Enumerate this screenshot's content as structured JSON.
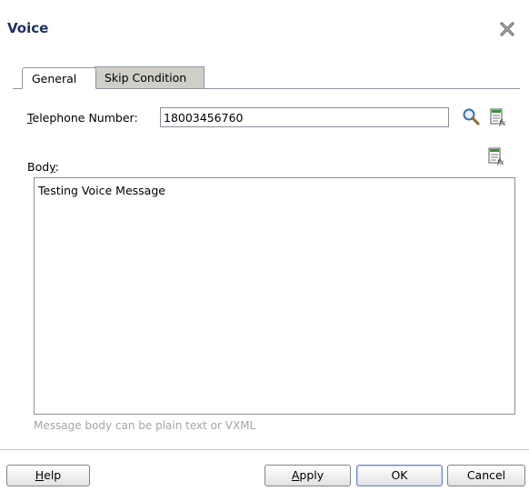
{
  "dialog": {
    "title": "Voice"
  },
  "tabs": [
    {
      "label": "General",
      "active": true
    },
    {
      "label": "Skip Condition",
      "active": false
    }
  ],
  "form": {
    "telephone_label_mnemonic": "T",
    "telephone_label_rest": "elephone Number:",
    "telephone_value": "18003456760",
    "body_label_prefix": "Bod",
    "body_label_mnemonic": "y",
    "body_label_suffix": ":",
    "body_value": "Testing Voice Message",
    "hint": "Message body can be plain text or VXML"
  },
  "buttons": {
    "help_mnemonic": "H",
    "help_rest": "elp",
    "apply_mnemonic": "A",
    "apply_rest": "pply",
    "ok": "OK",
    "cancel": "Cancel"
  },
  "icons": {
    "close": "close-icon",
    "search": "search-icon",
    "expression_builder": "expression-builder-icon"
  },
  "colors": {
    "title": "#1b2f5e",
    "inactive_tab": "#cfcfc7",
    "hint": "#a5a5a5"
  }
}
